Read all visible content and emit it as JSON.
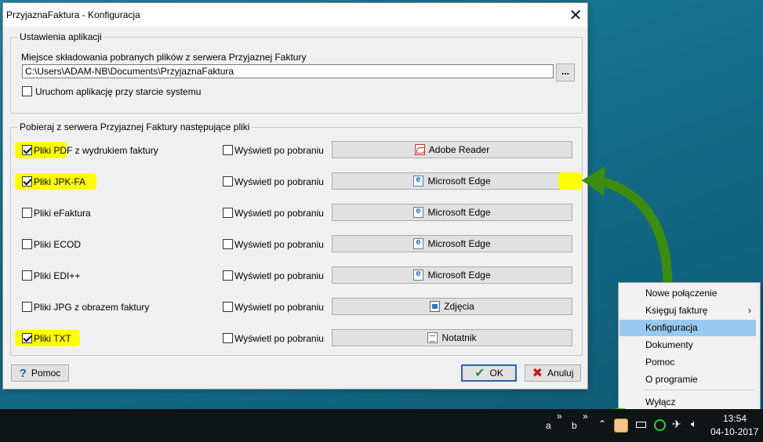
{
  "dialog": {
    "title": "PrzyjaznaFaktura - Konfiguracja",
    "close_glyph": "✕",
    "settings_group": {
      "legend": "Ustawienia aplikacji",
      "path_label": "Miejsce składowania pobranych plików z serwera Przyjaznej Faktury",
      "path_value": "C:\\Users\\ADAM-NB\\Documents\\PrzyjaznaFaktura",
      "browse_label": "...",
      "autostart_label": "Uruchom aplikację przy starcie systemu",
      "autostart_checked": false
    },
    "files_group": {
      "legend": "Pobieraj z serwera Przyjaznej Faktury następujące pliki",
      "rows": [
        {
          "label": "Pliki PDF",
          "label_extra": " z wydrukiem faktury",
          "checked": true,
          "highlighted": true,
          "show_label": "Wyświetl po pobraniu",
          "show_checked": false,
          "app": "Adobe Reader",
          "app_icon": "pdf-icon"
        },
        {
          "label": "Pliki JPK-FA",
          "label_extra": "",
          "checked": true,
          "highlighted": true,
          "show_label": "Wyświetl po pobraniu",
          "show_checked": false,
          "app": "Microsoft Edge",
          "app_icon": "edge-icon"
        },
        {
          "label": "Pliki eFaktura",
          "label_extra": "",
          "checked": false,
          "highlighted": false,
          "show_label": "Wyświetl po pobraniu",
          "show_checked": false,
          "app": "Microsoft Edge",
          "app_icon": "edge-icon"
        },
        {
          "label": "Pliki ECOD",
          "label_extra": "",
          "checked": false,
          "highlighted": false,
          "show_label": "Wyświetl po pobraniu",
          "show_checked": false,
          "app": "Microsoft Edge",
          "app_icon": "edge-icon"
        },
        {
          "label": "Pliki EDI++",
          "label_extra": "",
          "checked": false,
          "highlighted": false,
          "show_label": "Wyświetl po pobraniu",
          "show_checked": false,
          "app": "Microsoft Edge",
          "app_icon": "edge-icon"
        },
        {
          "label": "Pliki JPG z obrazem faktury",
          "label_extra": "",
          "checked": false,
          "highlighted": false,
          "show_label": "Wyświetl po pobraniu",
          "show_checked": false,
          "app": "Zdjęcia",
          "app_icon": "photos-icon"
        },
        {
          "label": "Pliki TXT",
          "label_extra": "",
          "checked": true,
          "highlighted": true,
          "show_label": "Wyświetl po pobraniu",
          "show_checked": false,
          "app": "Notatnik",
          "app_icon": "notepad-icon"
        }
      ]
    },
    "footer": {
      "help_label": "Pomoc",
      "ok_label": "OK",
      "cancel_label": "Anuluj"
    }
  },
  "context_menu": {
    "items": [
      {
        "label": "Nowe połączenie",
        "submenu": false,
        "selected": false
      },
      {
        "label": "Księguj fakturę",
        "submenu": true,
        "selected": false
      },
      {
        "label": "Konfiguracja",
        "submenu": false,
        "selected": true
      },
      {
        "label": "Dokumenty",
        "submenu": false,
        "selected": false
      },
      {
        "label": "Pomoc",
        "submenu": false,
        "selected": false
      },
      {
        "label": "O programie",
        "submenu": false,
        "selected": false
      },
      {
        "label": "Wyłącz",
        "submenu": false,
        "selected": false
      }
    ],
    "submenu_glyph": "›"
  },
  "taskbar": {
    "item_a": "a",
    "item_b": "b",
    "chevron": "»",
    "time": "13:54",
    "date": "04-10-2017"
  },
  "colors": {
    "highlight": "#ffff00",
    "annotation_green": "#3fcf1b",
    "arrow_green": "#3b8c0f",
    "menu_selected": "#99c9ef"
  }
}
